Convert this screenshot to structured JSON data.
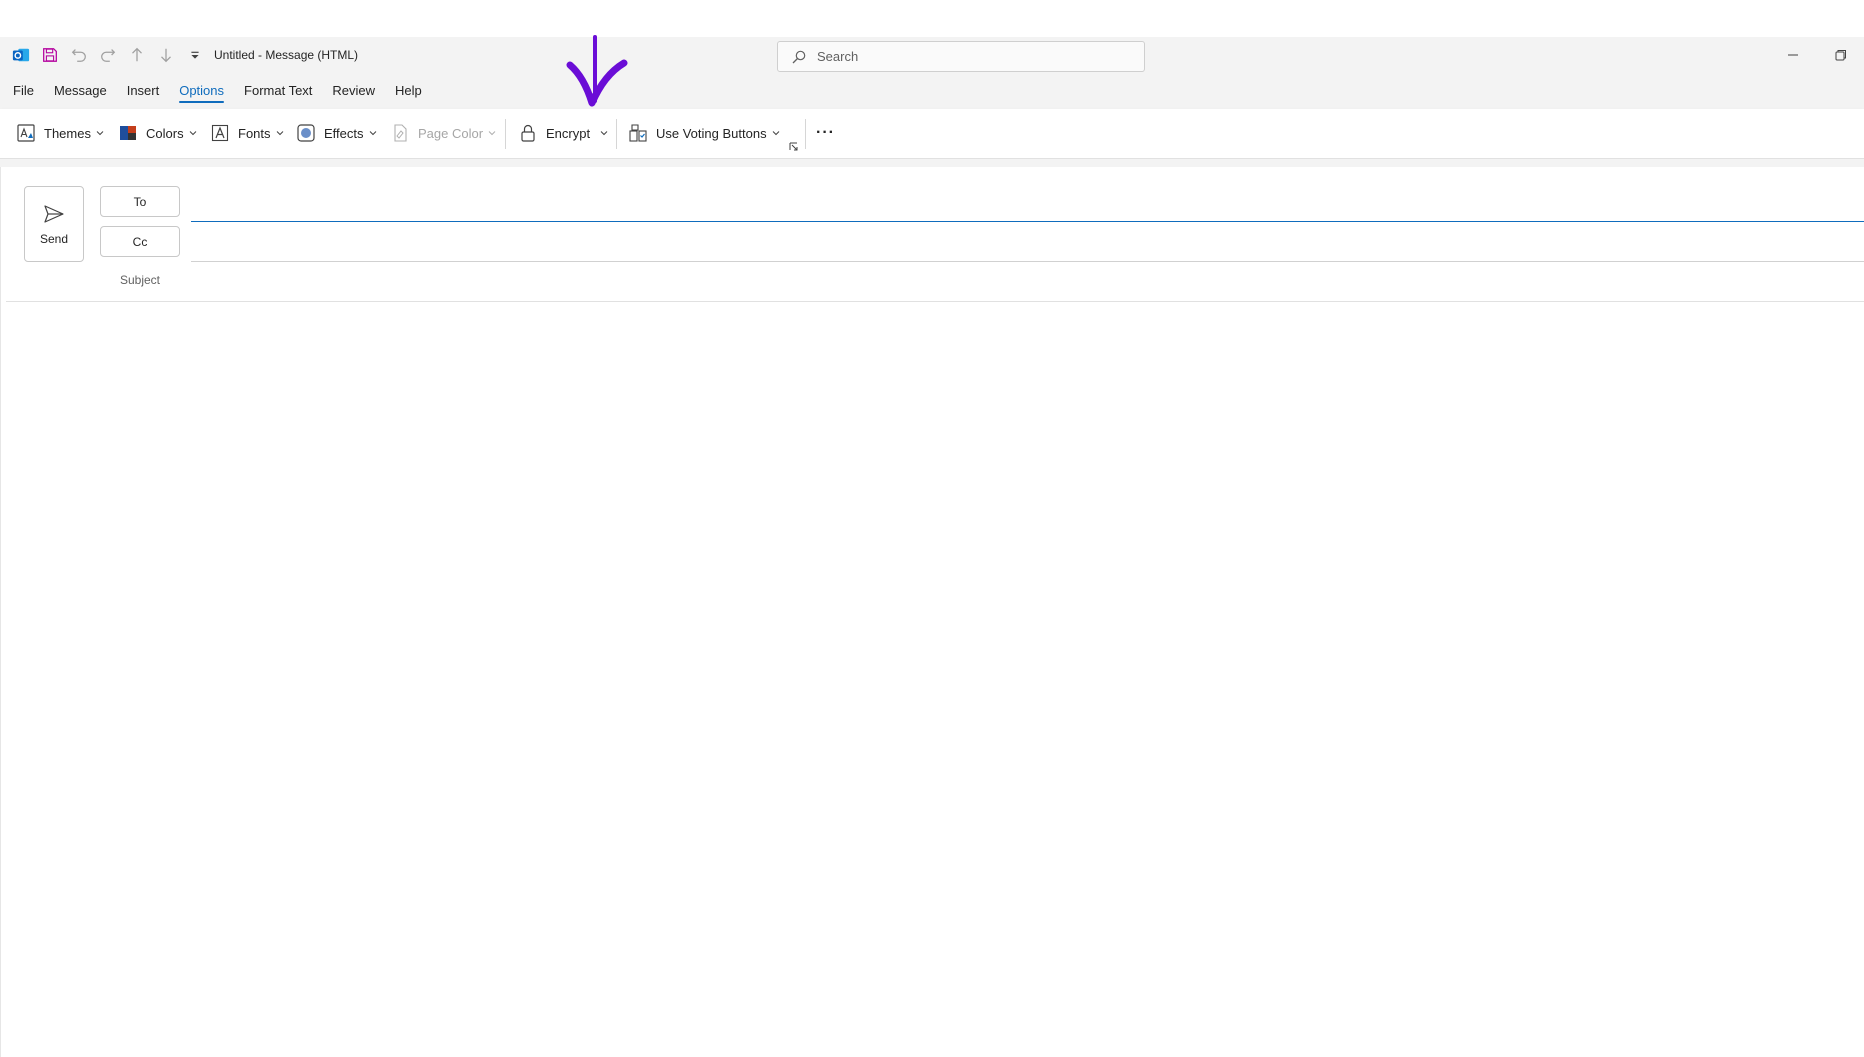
{
  "window": {
    "title": "Untitled  -  Message (HTML)"
  },
  "quick_access": {
    "icons": [
      "outlook-logo-icon",
      "save-icon",
      "undo-icon",
      "redo-icon",
      "previous-item-icon",
      "next-item-icon",
      "customize-toolbar-icon"
    ]
  },
  "search": {
    "placeholder": "Search"
  },
  "tabs": [
    "File",
    "Message",
    "Insert",
    "Options",
    "Format Text",
    "Review",
    "Help"
  ],
  "active_tab": "Options",
  "ribbon": {
    "themes": "Themes",
    "colors": "Colors",
    "fonts": "Fonts",
    "effects": "Effects",
    "page_color": "Page Color",
    "encrypt": "Encrypt",
    "voting": "Use Voting Buttons",
    "more": "···"
  },
  "compose": {
    "send": "Send",
    "to": "To",
    "cc": "Cc",
    "subject_label": "Subject",
    "to_value": "",
    "cc_value": "",
    "subject_value": ""
  },
  "colors": {
    "accent": "#0f6cbd",
    "annotation": "#6a0dd6",
    "outlook_blue": "#0a64c2"
  }
}
